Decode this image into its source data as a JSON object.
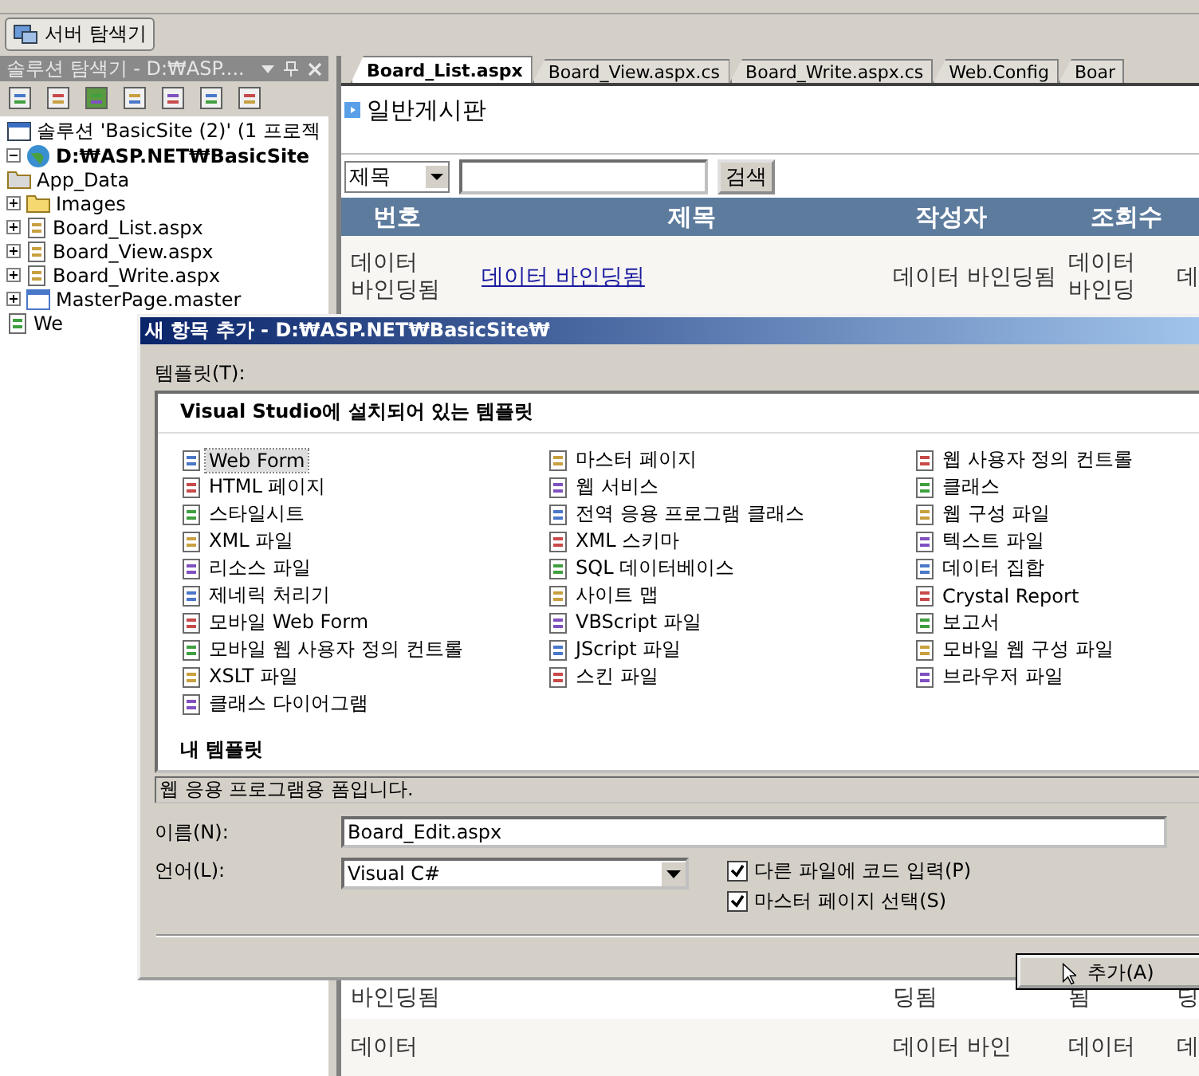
{
  "server_explorer_tab": {
    "label": "서버 탐색기"
  },
  "solution_explorer": {
    "title": "솔루션 탐색기 - D:₩ASP....",
    "tree": [
      {
        "label": "솔루션 'BasicSite (2)' (1 프로젝",
        "kind": "solution",
        "children": [
          {
            "label": "D:₩ASP.NET₩BasicSite",
            "kind": "project",
            "expanded": true,
            "children": [
              {
                "label": "App_Data",
                "kind": "folder-data"
              },
              {
                "label": "Images",
                "kind": "folder",
                "expanded": false
              },
              {
                "label": "Board_List.aspx",
                "kind": "page",
                "expanded": false
              },
              {
                "label": "Board_View.aspx",
                "kind": "page",
                "expanded": false
              },
              {
                "label": "Board_Write.aspx",
                "kind": "page",
                "expanded": false
              },
              {
                "label": "MasterPage.master",
                "kind": "master",
                "expanded": false
              },
              {
                "label": "We",
                "kind": "config"
              }
            ]
          }
        ]
      }
    ]
  },
  "editor_tabs": [
    {
      "label": "Board_List.aspx",
      "selected": true
    },
    {
      "label": "Board_View.aspx.cs",
      "selected": false
    },
    {
      "label": "Board_Write.aspx.cs",
      "selected": false
    },
    {
      "label": "Web.Config",
      "selected": false
    },
    {
      "label": "Boar",
      "selected": false
    }
  ],
  "designer": {
    "heading": "일반게시판",
    "search_select": "제목",
    "search_button": "검색",
    "grid": {
      "columns": [
        "번호",
        "제목",
        "작성자",
        "조회수"
      ],
      "first_row": [
        "데이터 바인딩됨",
        "데이터 바인딩됨",
        "데이터 바인딩됨",
        "데이터 바인딩",
        "데"
      ],
      "lower_rows": [
        [
          "바인딩됨",
          "",
          "딩됨",
          "됨",
          "딩"
        ],
        [
          "데이터",
          "",
          "데이터 바인",
          "데이터",
          "데"
        ]
      ]
    }
  },
  "dialog": {
    "title": "새 항목 추가 - D:₩ASP.NET₩BasicSite₩",
    "templates_label": "템플릿(T):",
    "installed_heading": "Visual Studio에 설치되어 있는 템플릿",
    "template_columns": [
      [
        {
          "label": "Web Form",
          "selected": true
        },
        {
          "label": "HTML 페이지",
          "selected": false
        },
        {
          "label": "스타일시트",
          "selected": false
        },
        {
          "label": "XML 파일",
          "selected": false
        },
        {
          "label": "리소스 파일",
          "selected": false
        },
        {
          "label": "제네릭 처리기",
          "selected": false
        },
        {
          "label": "모바일 Web Form",
          "selected": false
        },
        {
          "label": "모바일 웹 사용자 정의 컨트롤",
          "selected": false
        },
        {
          "label": "XSLT 파일",
          "selected": false
        },
        {
          "label": "클래스 다이어그램",
          "selected": false
        }
      ],
      [
        {
          "label": "마스터 페이지",
          "selected": false
        },
        {
          "label": "웹 서비스",
          "selected": false
        },
        {
          "label": "전역 응용 프로그램 클래스",
          "selected": false
        },
        {
          "label": "XML 스키마",
          "selected": false
        },
        {
          "label": "SQL 데이터베이스",
          "selected": false
        },
        {
          "label": "사이트 맵",
          "selected": false
        },
        {
          "label": "VBScript 파일",
          "selected": false
        },
        {
          "label": "JScript 파일",
          "selected": false
        },
        {
          "label": "스킨 파일",
          "selected": false
        }
      ],
      [
        {
          "label": "웹 사용자 정의 컨트롤",
          "selected": false
        },
        {
          "label": "클래스",
          "selected": false
        },
        {
          "label": "웹 구성 파일",
          "selected": false
        },
        {
          "label": "텍스트 파일",
          "selected": false
        },
        {
          "label": "데이터 집합",
          "selected": false
        },
        {
          "label": "Crystal Report",
          "selected": false
        },
        {
          "label": "보고서",
          "selected": false
        },
        {
          "label": "모바일 웹 구성 파일",
          "selected": false
        },
        {
          "label": "브라우저 파일",
          "selected": false
        }
      ]
    ],
    "my_templates_heading": "내 템플릿",
    "description": "웹 응용 프로그램용 폼입니다.",
    "name_label": "이름(N):",
    "name_value": "Board_Edit.aspx",
    "language_label": "언어(L):",
    "language_value": "Visual C#",
    "options": [
      {
        "label": "다른 파일에 코드 입력(P)",
        "checked": true
      },
      {
        "label": "마스터 페이지 선택(S)",
        "checked": true
      }
    ],
    "add_button": "추가(A)"
  }
}
